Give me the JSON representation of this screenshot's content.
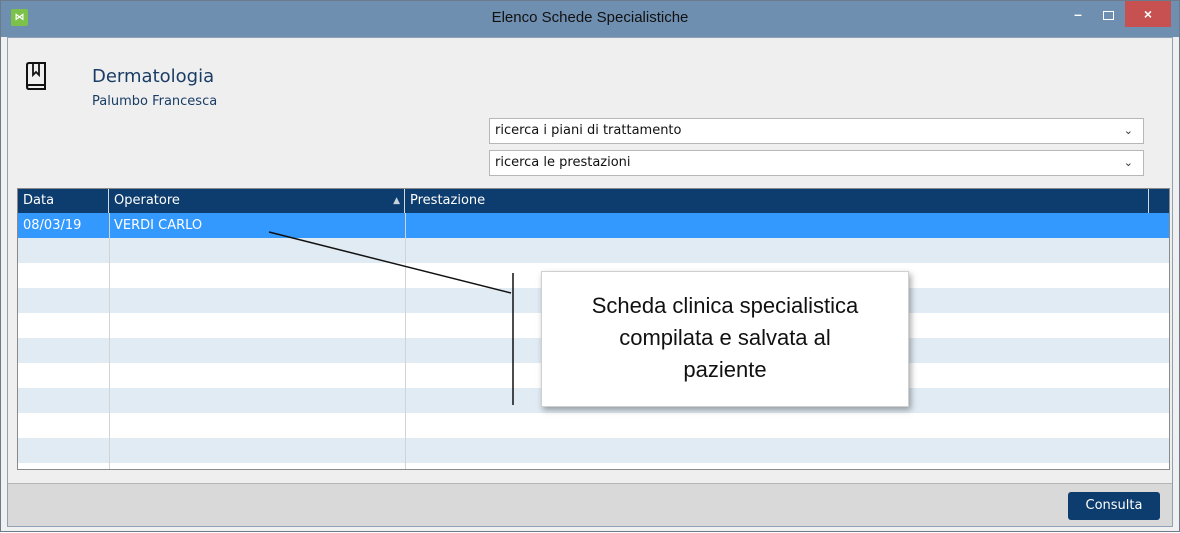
{
  "window": {
    "title": "Elenco Schede Specialistiche",
    "app_icon_glyph": "⋈",
    "minimize_glyph": "–",
    "close_glyph": "×"
  },
  "header": {
    "specialty": "Dermatologia",
    "patient": "Palumbo Francesca"
  },
  "filters": {
    "piani": "ricerca i piani di trattamento",
    "prestazioni": "ricerca le prestazioni",
    "chevron": "⌄"
  },
  "actions": {
    "add_glyph": "+",
    "remove_glyph": "−"
  },
  "table": {
    "columns": [
      "Data",
      "Operatore",
      "Prestazione"
    ],
    "sort_glyph": "▲",
    "rows": [
      {
        "data": "08/03/19",
        "operatore": "VERDI CARLO",
        "prestazione": "",
        "selected": true
      }
    ]
  },
  "callout": {
    "line1": "Scheda clinica specialistica",
    "line2": "compilata e salvata al",
    "line3": "paziente"
  },
  "footer": {
    "consulta_label": "Consulta"
  },
  "colors": {
    "header_bg": "#0d3c6e",
    "selected_row": "#3399ff",
    "alt_row": "#e1ebf4"
  }
}
